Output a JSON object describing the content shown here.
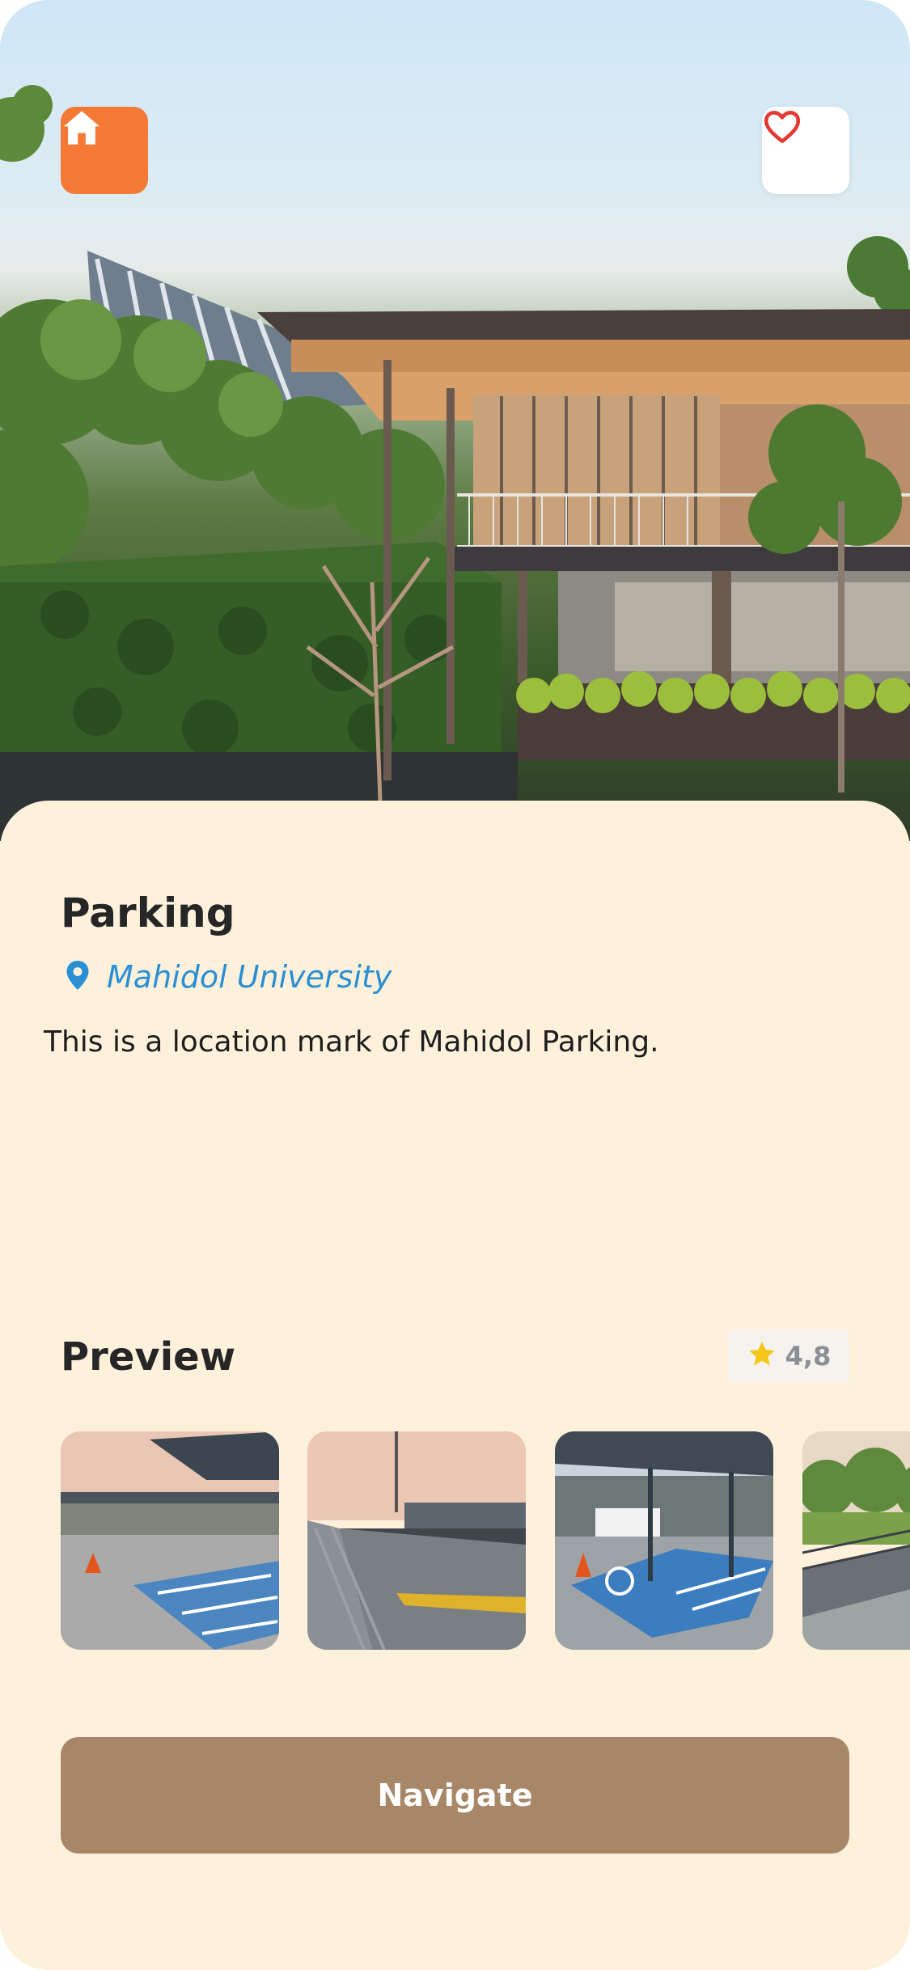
{
  "place": {
    "title": "Parking",
    "location": "Mahidol University",
    "description": "This is a location mark of Mahidol Parking."
  },
  "preview": {
    "title": "Preview",
    "rating": "4,8"
  },
  "actions": {
    "navigate_label": "Navigate"
  },
  "icons": {
    "home": "home-icon",
    "favorite": "heart-icon",
    "location": "location-pin-icon",
    "rating": "star-icon"
  },
  "colors": {
    "accent_orange": "#F47A35",
    "card_background": "#FDF1DB",
    "link_blue": "#2B8FD3",
    "navigate_button": "#A88768",
    "favorite_red": "#E53935",
    "star_yellow": "#F5C518"
  }
}
